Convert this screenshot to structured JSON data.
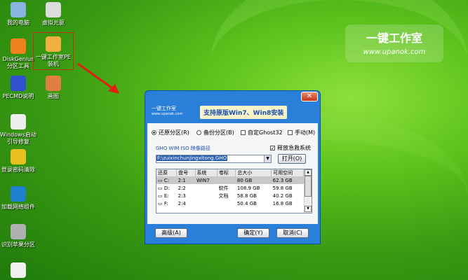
{
  "desktop": {
    "icons": [
      {
        "label": "我的电脑",
        "color": "#8ab4e0"
      },
      {
        "label": "DiskGenius分区工具",
        "color": "#f08020"
      },
      {
        "label": "PECMD说明",
        "color": "#3050d0"
      },
      {
        "label": "Windows启动引导修复",
        "color": "#eeeeee"
      },
      {
        "label": "登录密码清除",
        "color": "#e8c020"
      },
      {
        "label": "加载网络组件",
        "color": "#2080d0"
      },
      {
        "label": "识别苹果分区",
        "color": "#b0b0b0"
      },
      {
        "label": "",
        "color": "#f0f0f0"
      }
    ],
    "icons2": [
      {
        "label": "虚拟光驱",
        "color": "#dddddd"
      },
      {
        "label": "一键工作室PE装机",
        "color": "#f0b040"
      },
      {
        "label": "画图",
        "color": "#e08040"
      }
    ]
  },
  "brand": {
    "name": "一键工作室",
    "url": "www.upanok.com"
  },
  "dialog": {
    "close": "✕",
    "logo_name": "一键工作室",
    "logo_url": "www.upanok.com",
    "slogan": "支持原版Win7、Win8安装",
    "options": {
      "restore": "还原分区(R)",
      "backup": "备份分区(B)",
      "ghost32": "自定Ghost32",
      "manual": "手动(M)"
    },
    "path_label": "GHO WIM ISO 映像路径",
    "release_label": "释放急救系统",
    "path_value": "F:\\zuixinchunjingxitong.GHO",
    "open_btn": "打开(O)",
    "columns": [
      "还原",
      "盘号",
      "系统",
      "卷标",
      "总大小",
      "可用空间"
    ],
    "rows": [
      [
        "C:",
        "2:1",
        "WIN7",
        "",
        "80 GB",
        "62.3 GB"
      ],
      [
        "D:",
        "2:2",
        "",
        "软件",
        "108.9 GB",
        "59.8 GB"
      ],
      [
        "E:",
        "2:3",
        "",
        "文档",
        "58.8 GB",
        "40.2 GB"
      ],
      [
        "F:",
        "2:4",
        "",
        "",
        "50.4 GB",
        "16.8 GB"
      ]
    ],
    "advanced_btn": "高级(A)",
    "ok_btn": "确定(Y)",
    "cancel_btn": "取消(C)"
  }
}
